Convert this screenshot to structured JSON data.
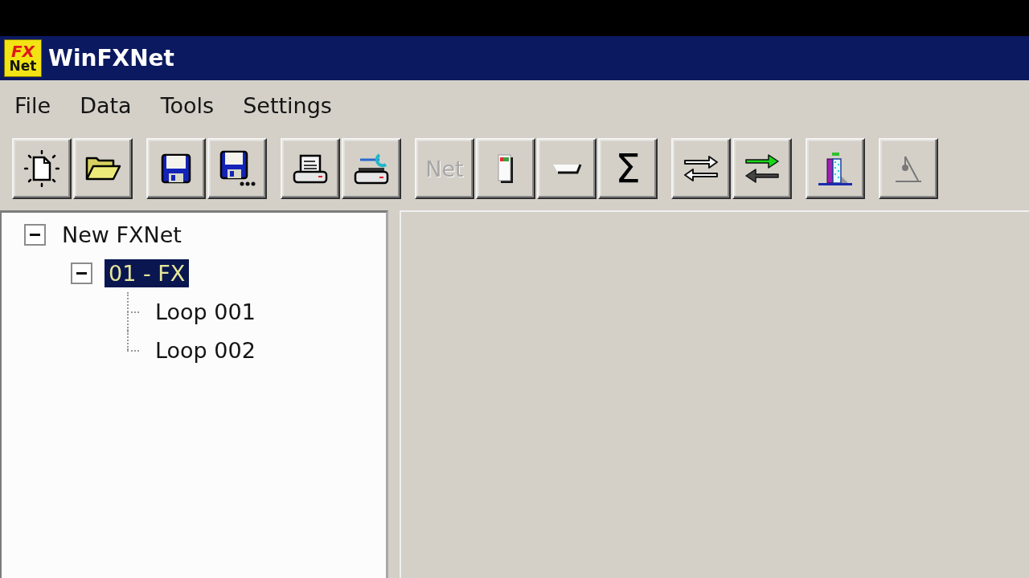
{
  "window": {
    "title": "WinFXNet",
    "logo": [
      "FX",
      "Net"
    ]
  },
  "menu": [
    "File",
    "Data",
    "Tools",
    "Settings"
  ],
  "toolbar": {
    "groups": [
      {
        "buttons": [
          {
            "kind": "new",
            "disabled": false
          },
          {
            "kind": "open",
            "disabled": false
          }
        ]
      },
      {
        "buttons": [
          {
            "kind": "save",
            "disabled": false
          },
          {
            "kind": "saveall",
            "disabled": false
          }
        ]
      },
      {
        "buttons": [
          {
            "kind": "print",
            "disabled": false
          },
          {
            "kind": "printsetup",
            "disabled": false
          }
        ]
      },
      {
        "buttons": [
          {
            "kind": "text",
            "label": "Net",
            "disabled": true
          },
          {
            "kind": "module",
            "disabled": false
          },
          {
            "kind": "tray",
            "disabled": false
          },
          {
            "kind": "text",
            "label": "Σ",
            "disabled": false
          }
        ]
      },
      {
        "buttons": [
          {
            "kind": "exchange",
            "disabled": false
          },
          {
            "kind": "transfer",
            "disabled": false
          }
        ]
      },
      {
        "buttons": [
          {
            "kind": "graph",
            "disabled": false
          }
        ]
      },
      {
        "buttons": [
          {
            "kind": "flask",
            "disabled": true
          }
        ]
      }
    ]
  },
  "tree": [
    {
      "label": "New FXNet",
      "expanded": true,
      "selected": false,
      "children": [
        {
          "label": "01 - FX",
          "expanded": true,
          "selected": true,
          "children": [
            {
              "label": "Loop 001",
              "selected": false
            },
            {
              "label": "Loop 002",
              "selected": false
            }
          ]
        }
      ]
    }
  ]
}
